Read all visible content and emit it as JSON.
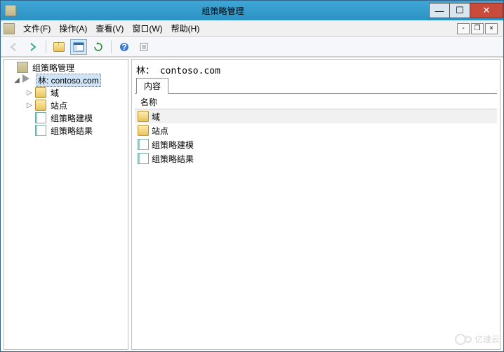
{
  "window": {
    "title": "组策略管理"
  },
  "menubar": {
    "file": "文件(F)",
    "action": "操作(A)",
    "view": "查看(V)",
    "window": "窗口(W)",
    "help": "帮助(H)"
  },
  "tree": {
    "root": "组策略管理",
    "forest": "林: contoso.com",
    "children": [
      {
        "label": "域",
        "expandable": true
      },
      {
        "label": "站点",
        "expandable": true
      },
      {
        "label": "组策略建模",
        "expandable": false
      },
      {
        "label": "组策略结果",
        "expandable": false
      }
    ]
  },
  "content": {
    "header": "林： contoso.com",
    "tab": "内容",
    "column": "名称",
    "rows": [
      {
        "label": "域",
        "icon": "folder",
        "selected": true
      },
      {
        "label": "站点",
        "icon": "folder",
        "selected": false
      },
      {
        "label": "组策略建模",
        "icon": "doc",
        "selected": false
      },
      {
        "label": "组策略结果",
        "icon": "doc",
        "selected": false
      }
    ]
  },
  "watermark": "亿速云"
}
